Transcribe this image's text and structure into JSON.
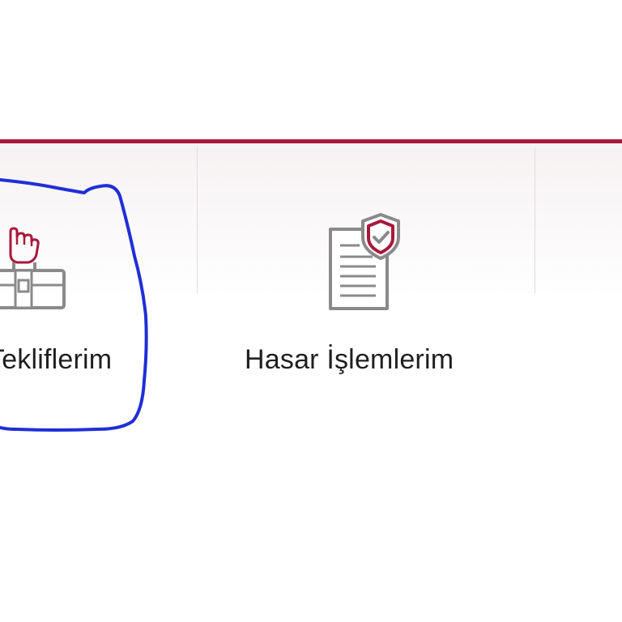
{
  "nav": {
    "items": [
      {
        "label": "Tekliflerim",
        "icon": "briefcase-hand-icon"
      },
      {
        "label": "Hasar İşlemlerim",
        "icon": "document-shield-icon"
      },
      {
        "label": "",
        "icon": ""
      }
    ]
  },
  "colors": {
    "accent": "#a8183a",
    "icon_gray": "#8a8a8a",
    "text": "#1f1f1f",
    "annotation": "#1f2fd6"
  }
}
